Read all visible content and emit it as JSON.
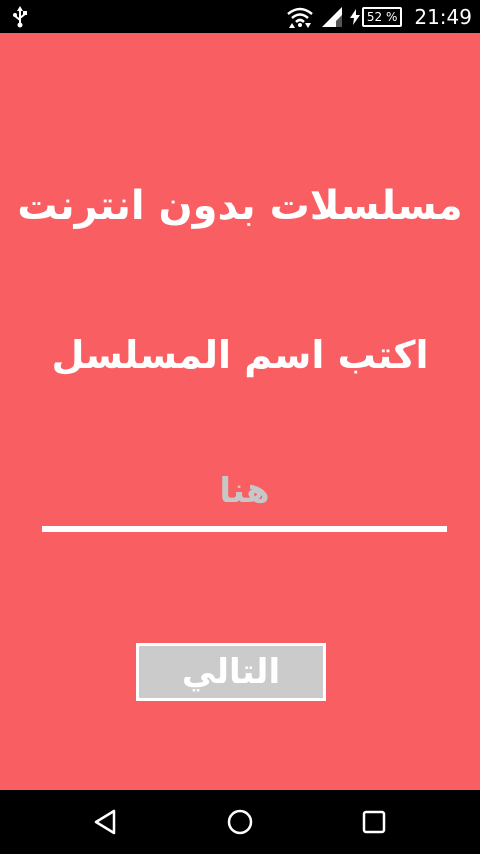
{
  "status_bar": {
    "battery_percent": "52 %",
    "time": "21:49",
    "icons": [
      "usb-icon",
      "wifi-icon",
      "signal-icon",
      "charging-bolt-icon",
      "battery-icon"
    ]
  },
  "main": {
    "app_title": "مسلسلات بدون انترنت",
    "prompt": "اكتب اسم المسلسل",
    "search_placeholder": "هنا",
    "search_value": "",
    "next_label": "التالي"
  },
  "nav_bar": {
    "icons": [
      "back-icon",
      "home-icon",
      "recents-icon"
    ]
  },
  "colors": {
    "background": "#f95f62",
    "button": "#cbcbcb",
    "text": "#ffffff",
    "placeholder": "#c7c7c7"
  }
}
